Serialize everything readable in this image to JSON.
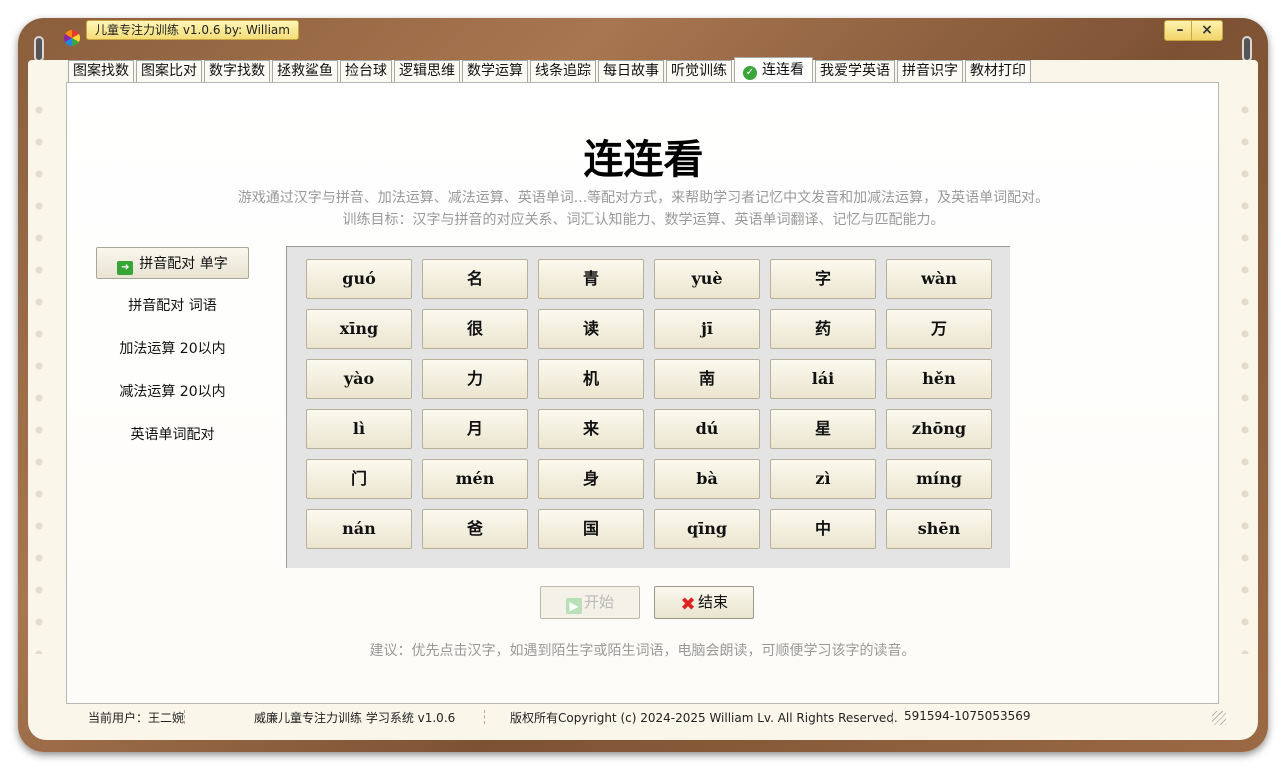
{
  "window": {
    "title": "儿童专注力训练 v1.0.6 by: William",
    "minimize_label": "–",
    "close_label": "×"
  },
  "tabs": [
    {
      "label": "图案找数"
    },
    {
      "label": "图案比对"
    },
    {
      "label": "数字找数"
    },
    {
      "label": "拯救鲨鱼"
    },
    {
      "label": "捡台球"
    },
    {
      "label": "逻辑思维"
    },
    {
      "label": "数学运算"
    },
    {
      "label": "线条追踪"
    },
    {
      "label": "每日故事"
    },
    {
      "label": "听觉训练"
    },
    {
      "label": "连连看",
      "active": true
    },
    {
      "label": "我爱学英语"
    },
    {
      "label": "拼音识字"
    },
    {
      "label": "教材打印"
    }
  ],
  "page": {
    "title": "连连看",
    "description": "游戏通过汉字与拼音、加法运算、减法运算、英语单词...等配对方式，来帮助学习者记忆中文发音和加减法运算，及英语单词配对。",
    "goal": "训练目标：汉字与拼音的对应关系、词汇认知能力、数学运算、英语单词翻译、记忆与匹配能力。",
    "tip": "建议：优先点击汉字，如遇到陌生字或陌生词语，电脑会朗读，可顺便学习该字的读音。"
  },
  "menu": [
    {
      "label": "拼音配对  单字",
      "selected": true
    },
    {
      "label": "拼音配对  词语"
    },
    {
      "label": "加法运算  20以内"
    },
    {
      "label": "减法运算  20以内"
    },
    {
      "label": "英语单词配对"
    }
  ],
  "board": {
    "rows": [
      [
        "guó",
        "名",
        "青",
        "yuè",
        "字",
        "wàn"
      ],
      [
        "xīng",
        "很",
        "读",
        "jī",
        "药",
        "万"
      ],
      [
        "yào",
        "力",
        "机",
        "南",
        "lái",
        "hěn"
      ],
      [
        "lì",
        "月",
        "来",
        "dú",
        "星",
        "zhōng"
      ],
      [
        "门",
        "mén",
        "身",
        "bà",
        "zì",
        "míng"
      ],
      [
        "nán",
        "爸",
        "国",
        "qīng",
        "中",
        "shēn"
      ]
    ]
  },
  "buttons": {
    "start_label": "开始",
    "end_label": "结束"
  },
  "status": {
    "user": "当前用户：王二婉",
    "system": "威廉儿童专注力训练 学习系统 v1.0.6",
    "copyright": "版权所有Copyright (c) 2024-2025 William Lv. All Rights Reserved.",
    "contact": "591594-1075053569"
  }
}
